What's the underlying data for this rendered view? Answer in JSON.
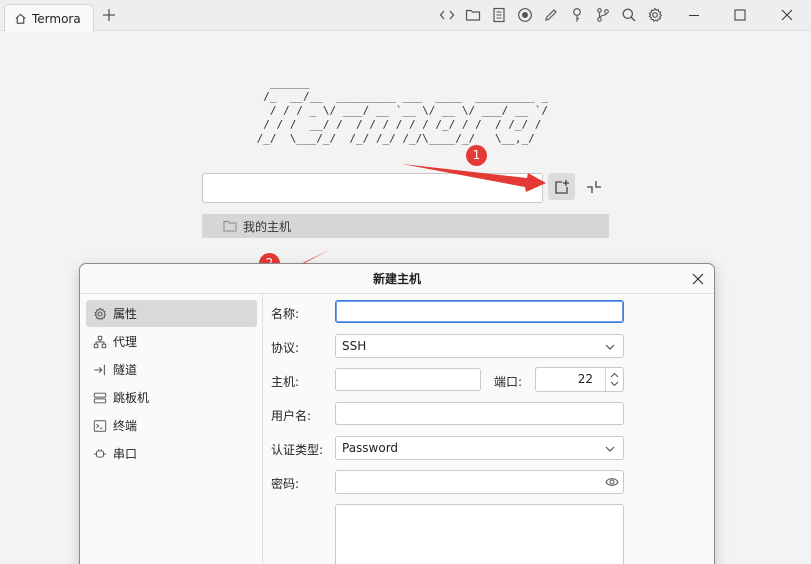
{
  "titlebar": {
    "tab_label": "Termora",
    "icons": [
      "code-icon",
      "folder-icon",
      "notes-icon",
      "record-icon",
      "pen-icon",
      "key-icon",
      "branch-icon",
      "search-icon",
      "gear-icon"
    ],
    "window_controls": [
      "minimize",
      "maximize",
      "close"
    ]
  },
  "home": {
    "ascii_logo": "   ______\n  /_  __/__  _________ ___  ____  _________ _\n   / / / _ \\/ ___/ __ `__ \\/ __ \\/ ___/ __ `/\n  / / /  __/ /  / / / / / / /_/ / /  / /_/ /\n /_/  \\___/_/  /_/ /_/ /_/\\____/_/   \\__,_/",
    "search_value": "",
    "folder_label": "我的主机"
  },
  "annotations": {
    "badge_1": "1",
    "badge_2": "2",
    "color": "#e53935"
  },
  "dialog": {
    "title": "新建主机",
    "sidebar": [
      {
        "label": "属性",
        "icon": "gear-icon",
        "active": true
      },
      {
        "label": "代理",
        "icon": "network-icon",
        "active": false
      },
      {
        "label": "隧道",
        "icon": "tunnel-icon",
        "active": false
      },
      {
        "label": "跳板机",
        "icon": "server-icon",
        "active": false
      },
      {
        "label": "终端",
        "icon": "terminal-icon",
        "active": false
      },
      {
        "label": "串口",
        "icon": "plug-icon",
        "active": false
      }
    ],
    "form": {
      "name_label": "名称:",
      "name_value": "",
      "protocol_label": "协议:",
      "protocol_value": "SSH",
      "host_label": "主机:",
      "host_value": "",
      "port_label": "端口:",
      "port_value": "22",
      "username_label": "用户名:",
      "username_value": "",
      "auth_label": "认证类型:",
      "auth_value": "Password",
      "password_label": "密码:",
      "password_value": "",
      "notes_value": ""
    }
  }
}
